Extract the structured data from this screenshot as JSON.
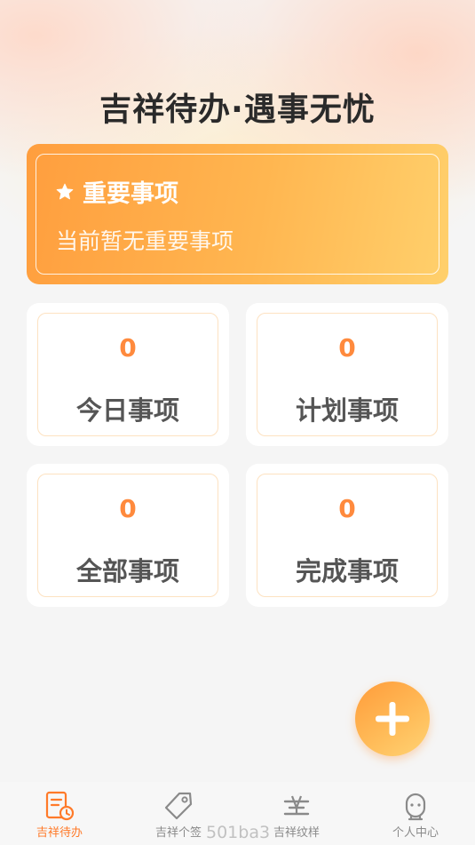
{
  "header": {
    "slogan": "吉祥待办·遇事无忧"
  },
  "important": {
    "title": "重要事项",
    "empty_text": "当前暂无重要事项"
  },
  "stats": [
    {
      "count": "0",
      "label": "今日事项"
    },
    {
      "count": "0",
      "label": "计划事项"
    },
    {
      "count": "0",
      "label": "全部事项"
    },
    {
      "count": "0",
      "label": "完成事项"
    }
  ],
  "tabbar": {
    "items": [
      {
        "label": "吉祥待办",
        "icon": "todo-clock-icon",
        "active": true
      },
      {
        "label": "吉祥个签",
        "icon": "tag-icon",
        "active": false
      },
      {
        "label": "吉祥纹样",
        "icon": "pattern-icon",
        "active": false
      },
      {
        "label": "个人中心",
        "icon": "profile-icon",
        "active": false
      }
    ]
  },
  "watermark": "501ba3",
  "colors": {
    "accent": "#ff8a3d",
    "active_tab": "#ff7a29",
    "tile_border": "#fde2c1"
  }
}
